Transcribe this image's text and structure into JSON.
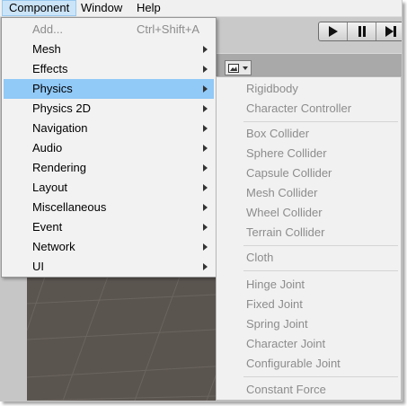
{
  "menubar": {
    "items": [
      "Component",
      "Window",
      "Help"
    ]
  },
  "toolbar": {
    "play_icon": "play-icon",
    "pause_icon": "pause-icon",
    "step_icon": "step-icon"
  },
  "component_menu": {
    "add_label": "Add...",
    "add_shortcut": "Ctrl+Shift+A",
    "items": [
      "Mesh",
      "Effects",
      "Physics",
      "Physics 2D",
      "Navigation",
      "Audio",
      "Rendering",
      "Layout",
      "Miscellaneous",
      "Event",
      "Network",
      "UI"
    ],
    "highlighted": "Physics",
    "highlight_color": "#91c9f7"
  },
  "physics_submenu": {
    "group1": [
      "Rigidbody",
      "Character Controller"
    ],
    "group2": [
      "Box Collider",
      "Sphere Collider",
      "Capsule Collider",
      "Mesh Collider",
      "Wheel Collider",
      "Terrain Collider"
    ],
    "group3": [
      "Cloth"
    ],
    "group4": [
      "Hinge Joint",
      "Fixed Joint",
      "Spring Joint",
      "Character Joint",
      "Configurable Joint"
    ],
    "group5": [
      "Constant Force"
    ]
  }
}
